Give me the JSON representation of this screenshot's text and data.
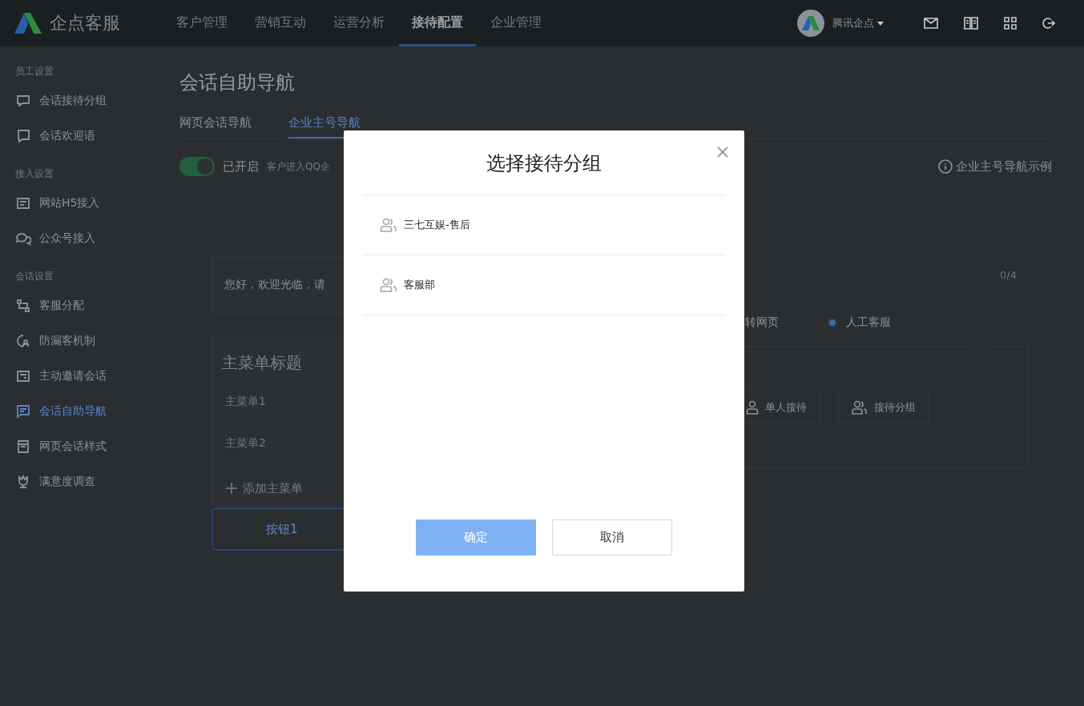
{
  "header": {
    "logo_text": "企点客服",
    "nav": [
      {
        "label": "客户管理",
        "selected": false
      },
      {
        "label": "营销互动",
        "selected": false
      },
      {
        "label": "运营分析",
        "selected": false
      },
      {
        "label": "接待配置",
        "selected": true
      },
      {
        "label": "企业管理",
        "selected": false
      }
    ],
    "account": "腾讯企点"
  },
  "sidebar": {
    "sections": [
      {
        "title": "员工设置",
        "items": [
          {
            "label": "会话接待分组",
            "selected": false
          },
          {
            "label": "会话欢迎语",
            "selected": false
          }
        ]
      },
      {
        "title": "接入设置",
        "items": [
          {
            "label": "网站H5接入",
            "selected": false
          },
          {
            "label": "公众号接入",
            "selected": false
          }
        ]
      },
      {
        "title": "会话设置",
        "items": [
          {
            "label": "客服分配",
            "selected": false
          },
          {
            "label": "防漏客机制",
            "selected": false
          },
          {
            "label": "主动邀请会话",
            "selected": false
          },
          {
            "label": "会话自助导航",
            "selected": true
          },
          {
            "label": "网页会话样式",
            "selected": false
          },
          {
            "label": "满意度调查",
            "selected": false
          }
        ]
      }
    ]
  },
  "page": {
    "title": "会话自助导航",
    "tabs": [
      {
        "label": "网页会话导航",
        "selected": false
      },
      {
        "label": "企业主号导航",
        "selected": true
      }
    ],
    "toggle": {
      "on": true,
      "label": "已开启",
      "description": "客户进入QQ企"
    },
    "example_link": "企业主号导航示例",
    "preview": {
      "greeting": "您好，欢迎光临，请",
      "menu_title": "主菜单标题",
      "menu_items": [
        "主菜单1",
        "主菜单2"
      ],
      "add_menu": "添加主菜单",
      "button": "按钮1"
    },
    "editor": {
      "counter": "0/4",
      "options": [
        {
          "label": "转网页"
        },
        {
          "label": "人工客服",
          "selected": true
        }
      ],
      "reception": [
        {
          "label": "单人接待",
          "kind": "single"
        },
        {
          "label": "接待分组",
          "kind": "group"
        }
      ]
    }
  },
  "dialog": {
    "title": "选择接待分组",
    "groups": [
      "三七互娱-售后",
      "客服部"
    ],
    "confirm": "确定",
    "cancel": "取消"
  }
}
